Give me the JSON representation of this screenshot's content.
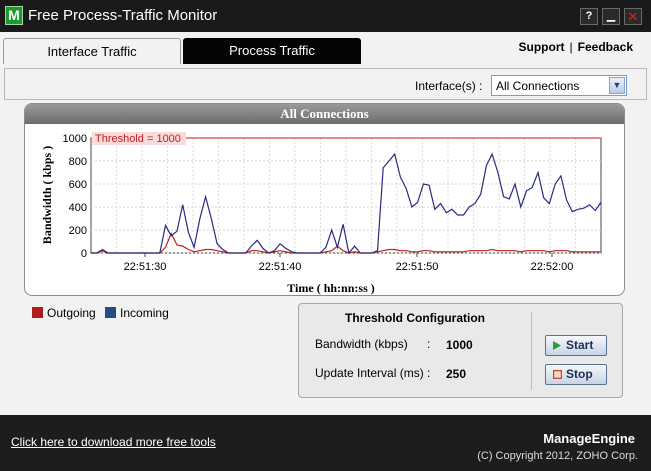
{
  "window": {
    "icon_letter": "M",
    "title": "Free Process-Traffic Monitor",
    "help_label": "?",
    "minimize_label": "▁",
    "close_label": "✕"
  },
  "tabs": [
    {
      "label": "Interface Traffic",
      "active": true
    },
    {
      "label": "Process Traffic",
      "active": false
    }
  ],
  "toplinks": {
    "support": "Support",
    "separator": "|",
    "feedback": "Feedback"
  },
  "interface": {
    "label": "Interface(s) :",
    "selected": "All Connections",
    "dropdown_icon": "chevron-down-icon"
  },
  "chart_panel_title": "All Connections",
  "chart_data": {
    "type": "line",
    "title": "All Connections",
    "xlabel": "Time ( hh:nn:ss )",
    "ylabel": "Bandwidth ( kbps )",
    "ylim": [
      0,
      1000
    ],
    "yticks": [
      "0",
      "200",
      "400",
      "600",
      "800",
      "1000"
    ],
    "x_tick_labels": [
      "22:51:30",
      "22:51:40",
      "22:51:50",
      "22:52:00"
    ],
    "threshold": {
      "label": "Threshold  = 1000",
      "value": 1000,
      "color": "#e06060"
    },
    "grid": true,
    "series": [
      {
        "name": "Incoming",
        "color": "#2a2a80",
        "values": [
          0,
          0,
          20,
          0,
          0,
          0,
          0,
          0,
          0,
          0,
          0,
          0,
          0,
          240,
          150,
          190,
          420,
          180,
          50,
          300,
          490,
          300,
          80,
          30,
          0,
          0,
          0,
          0,
          60,
          110,
          40,
          0,
          20,
          80,
          40,
          10,
          0,
          0,
          0,
          0,
          0,
          50,
          200,
          50,
          250,
          0,
          60,
          0,
          0,
          0,
          20,
          740,
          800,
          860,
          660,
          560,
          400,
          440,
          600,
          590,
          380,
          430,
          350,
          380,
          330,
          330,
          400,
          430,
          510,
          760,
          860,
          700,
          490,
          470,
          600,
          400,
          540,
          570,
          700,
          480,
          430,
          600,
          670,
          460,
          360,
          380,
          390,
          420,
          370,
          440
        ]
      },
      {
        "name": "Outgoing",
        "color": "#c02020",
        "values": [
          0,
          0,
          30,
          0,
          0,
          0,
          0,
          0,
          0,
          0,
          0,
          0,
          0,
          50,
          170,
          70,
          60,
          30,
          10,
          20,
          30,
          30,
          20,
          10,
          0,
          0,
          0,
          0,
          20,
          20,
          10,
          0,
          10,
          20,
          10,
          0,
          0,
          0,
          0,
          0,
          0,
          10,
          20,
          60,
          20,
          0,
          10,
          0,
          0,
          0,
          10,
          20,
          30,
          30,
          20,
          20,
          10,
          10,
          20,
          20,
          10,
          10,
          10,
          10,
          10,
          10,
          20,
          20,
          20,
          20,
          30,
          20,
          20,
          20,
          20,
          10,
          20,
          20,
          20,
          20,
          10,
          20,
          20,
          20,
          10,
          10,
          10,
          10,
          10,
          10
        ]
      }
    ]
  },
  "legend": [
    {
      "label": "Outgoing",
      "color": "#b01c1c"
    },
    {
      "label": "Incoming",
      "color": "#1e4f7f"
    }
  ],
  "threshold_config": {
    "title": "Threshold Configuration",
    "bandwidth_label": "Bandwidth (kbps)",
    "bandwidth_value": "1000",
    "interval_label": "Update Interval (ms)",
    "interval_value": "250",
    "colon": ":",
    "start_label": "Start",
    "stop_label": "Stop"
  },
  "footer": {
    "download_link": "Click here to download more free tools",
    "brand": "ManageEngine",
    "copyright": "(C) Copyright 2012, ZOHO Corp."
  }
}
